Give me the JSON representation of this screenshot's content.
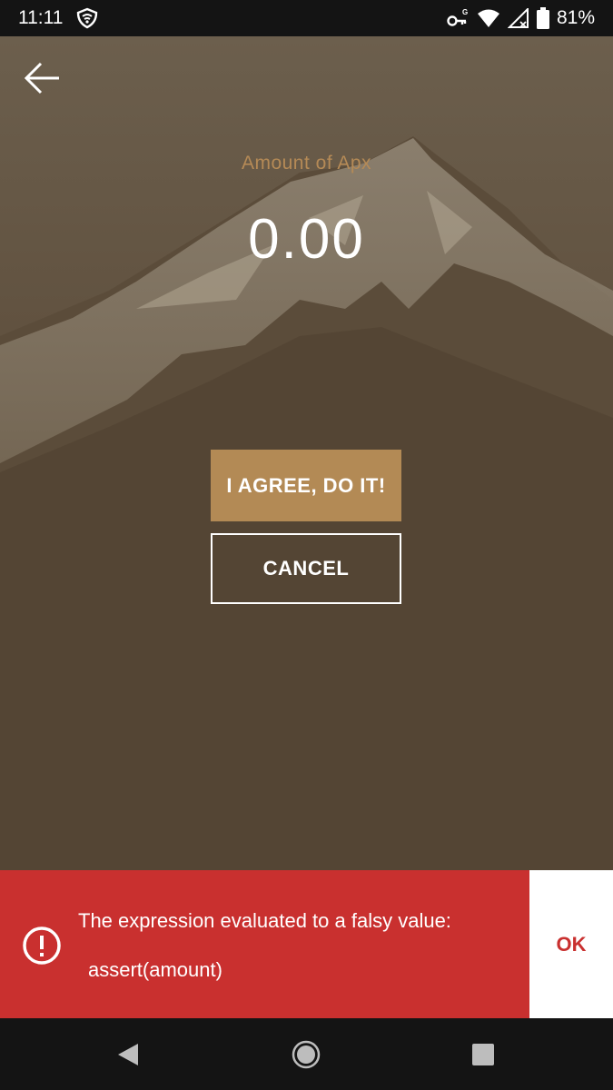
{
  "status_bar": {
    "time": "11:11",
    "battery_percent": "81%",
    "icons": [
      "shield-icon",
      "key-icon",
      "wifi-icon",
      "signal-icon",
      "battery-icon"
    ]
  },
  "screen": {
    "back_icon": "arrow-left-icon",
    "amount_label": "Amount of Apx",
    "amount_value": "0.00",
    "agree_button": "I AGREE, DO IT!",
    "cancel_button": "CANCEL",
    "colors": {
      "accent": "#b38a55",
      "background": "#574734"
    }
  },
  "snackbar": {
    "icon": "error-icon",
    "message": "The expression evaluated to a falsy value:",
    "code": "assert(amount)",
    "action": "OK",
    "color": "#c9302f"
  },
  "nav_bar": {
    "icons": [
      "nav-back-icon",
      "nav-home-icon",
      "nav-recents-icon"
    ]
  }
}
